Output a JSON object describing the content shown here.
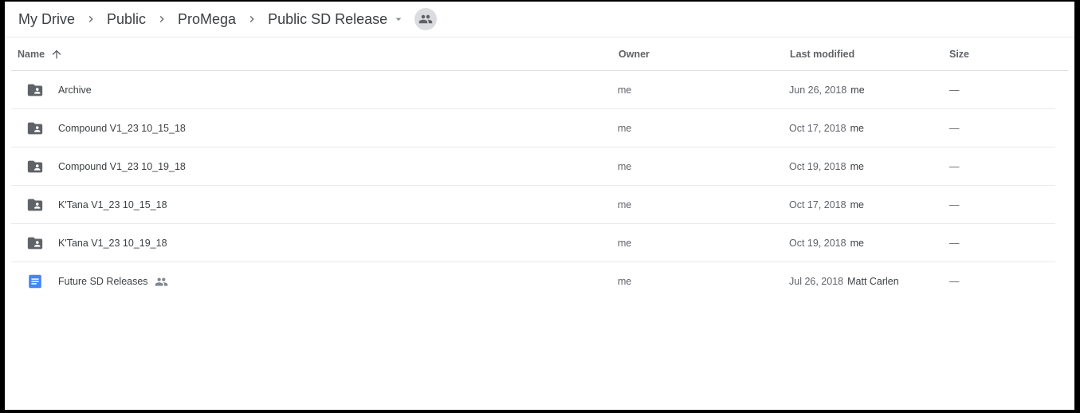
{
  "breadcrumb": {
    "items": [
      "My Drive",
      "Public",
      "ProMega",
      "Public SD Release"
    ]
  },
  "table": {
    "columns": {
      "name": "Name",
      "owner": "Owner",
      "last_modified": "Last modified",
      "size": "Size"
    },
    "rows": [
      {
        "type": "shared-folder",
        "name": "Archive",
        "owner": "me",
        "modified_date": "Jun 26, 2018",
        "modified_by": "me",
        "size": "—"
      },
      {
        "type": "shared-folder",
        "name": "Compound V1_23 10_15_18",
        "owner": "me",
        "modified_date": "Oct 17, 2018",
        "modified_by": "me",
        "size": "—"
      },
      {
        "type": "shared-folder",
        "name": "Compound V1_23 10_19_18",
        "owner": "me",
        "modified_date": "Oct 19, 2018",
        "modified_by": "me",
        "size": "—"
      },
      {
        "type": "shared-folder",
        "name": "K'Tana V1_23 10_15_18",
        "owner": "me",
        "modified_date": "Oct 17, 2018",
        "modified_by": "me",
        "size": "—"
      },
      {
        "type": "shared-folder",
        "name": "K'Tana V1_23 10_19_18",
        "owner": "me",
        "modified_date": "Oct 19, 2018",
        "modified_by": "me",
        "size": "—"
      },
      {
        "type": "google-doc",
        "name": "Future SD Releases",
        "shared": true,
        "owner": "me",
        "modified_date": "Jul 26, 2018",
        "modified_by": "Matt Carlen",
        "size": "—"
      }
    ]
  },
  "colors": {
    "folder_icon": "#5f6368",
    "doc_icon": "#4285f4",
    "text_primary": "#3c4043",
    "text_secondary": "#5f6368",
    "divider": "#e8eaed"
  }
}
